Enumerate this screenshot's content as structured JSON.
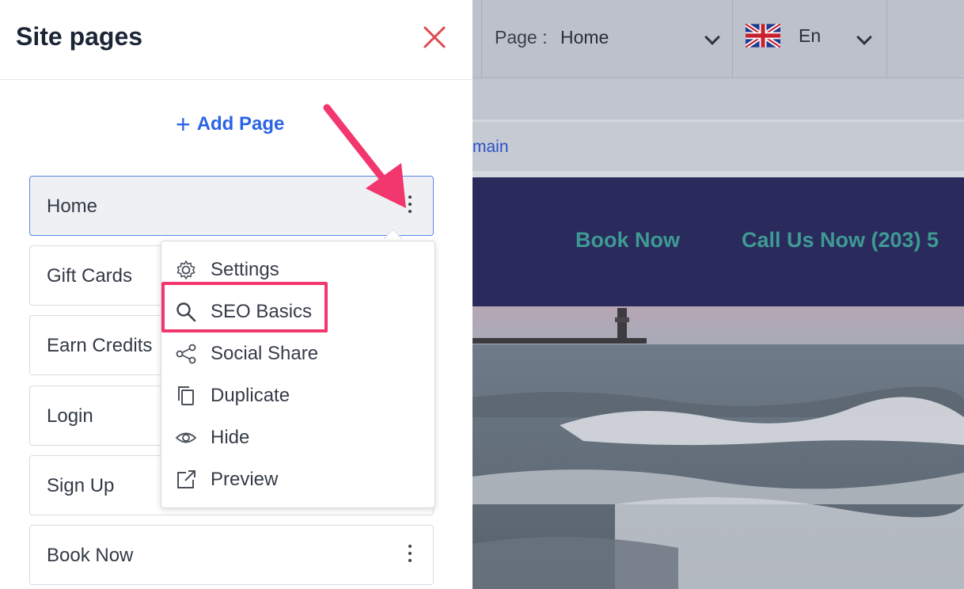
{
  "panel": {
    "title": "Site pages",
    "add_page_label": "Add Page",
    "pages": [
      {
        "label": "Home"
      },
      {
        "label": "Gift Cards"
      },
      {
        "label": "Earn Credits"
      },
      {
        "label": "Login"
      },
      {
        "label": "Sign Up"
      },
      {
        "label": "Book Now"
      }
    ]
  },
  "menu": {
    "items": [
      {
        "label": "Settings",
        "icon": "gear-icon"
      },
      {
        "label": "SEO Basics",
        "icon": "search-icon"
      },
      {
        "label": "Social Share",
        "icon": "share-icon"
      },
      {
        "label": "Duplicate",
        "icon": "copy-icon"
      },
      {
        "label": "Hide",
        "icon": "eye-icon"
      },
      {
        "label": "Preview",
        "icon": "external-link-icon"
      }
    ]
  },
  "toolbar": {
    "page_label": "Page :",
    "page_value": "Home",
    "language": "En",
    "flag_icon": "uk-flag-icon"
  },
  "site": {
    "domain_link": "main",
    "nav_book": "Book Now",
    "nav_call": "Call Us Now (203) 5"
  },
  "colors": {
    "accent_blue": "#2a63e6",
    "close_red": "#e0484d",
    "annotation_pink": "#f2366e",
    "site_header": "#2a2a5c",
    "nav_teal": "#3e9a93"
  }
}
